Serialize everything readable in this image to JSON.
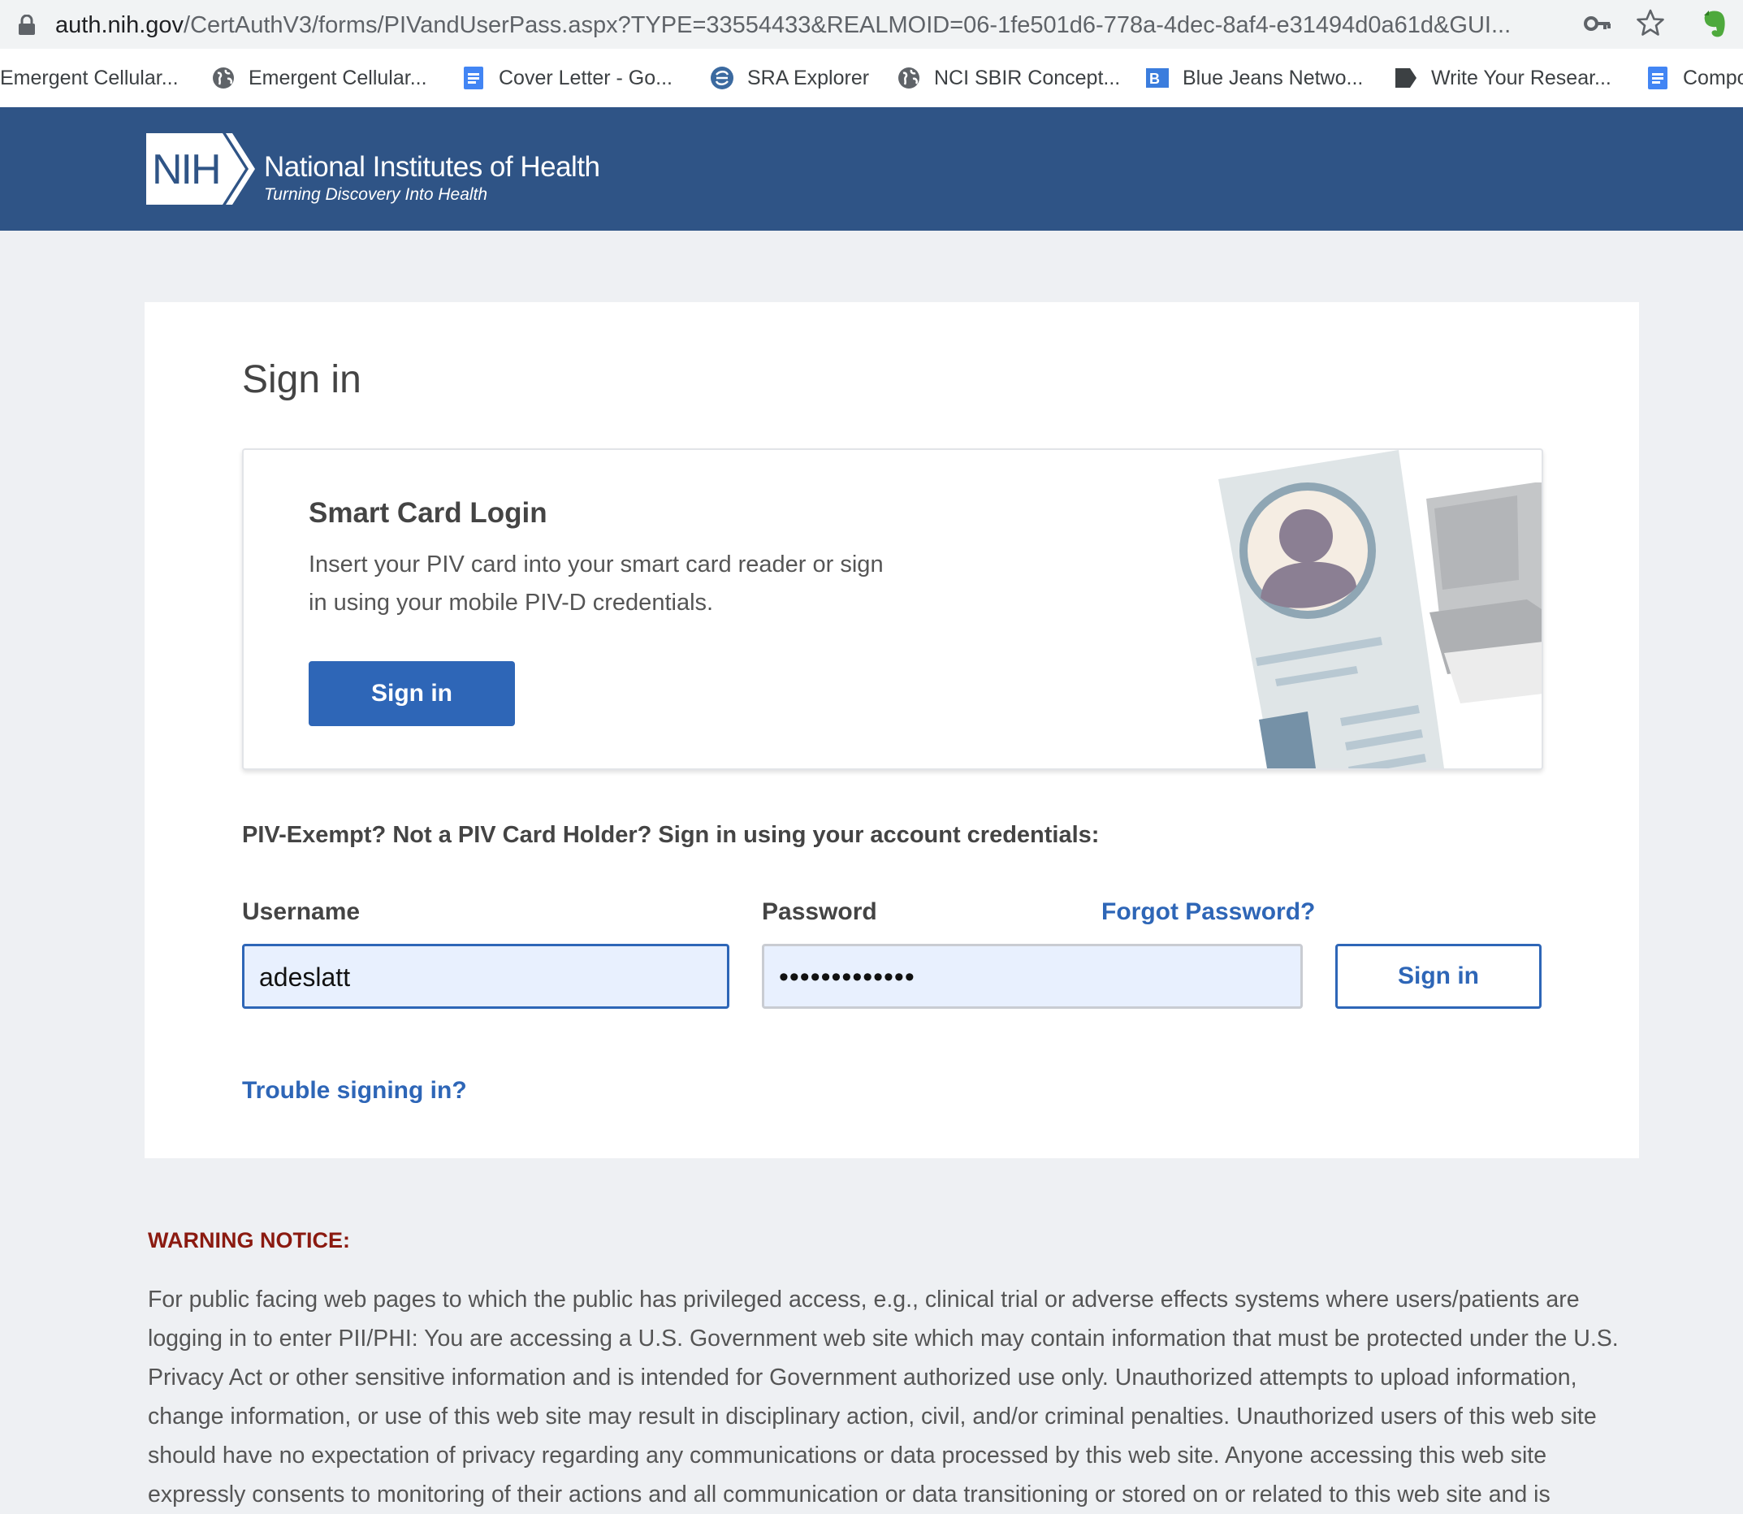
{
  "browser": {
    "url_host": "auth.nih.gov",
    "url_path": "/CertAuthV3/forms/PIVandUserPass.aspx?TYPE=33554433&REALMOID=06-1fe501d6-778a-4dec-8af4-e31494d0a61d&GUI...",
    "icons": [
      "lock-icon",
      "key-icon",
      "star-icon",
      "evernote-icon"
    ]
  },
  "bookmarks": [
    {
      "label": "Emergent Cellular...",
      "icon": "none"
    },
    {
      "label": "Emergent Cellular...",
      "icon": "globe-icon"
    },
    {
      "label": "Cover Letter - Go...",
      "icon": "docs-icon"
    },
    {
      "label": "SRA Explorer",
      "icon": "sra-icon"
    },
    {
      "label": "NCI SBIR Concept...",
      "icon": "globe-icon"
    },
    {
      "label": "Blue Jeans Netwo...",
      "icon": "bluejeans-icon"
    },
    {
      "label": "Write Your Resear...",
      "icon": "flag-icon"
    },
    {
      "label": "Compo",
      "icon": "docs-icon"
    }
  ],
  "header": {
    "logo_text": "NIH",
    "org_name": "National Institutes of Health",
    "tagline": "Turning Discovery Into Health",
    "bg_color": "#2f5486"
  },
  "signin": {
    "title": "Sign in",
    "smart_card": {
      "title": "Smart Card Login",
      "description": "Insert your PIV card into your smart card reader or sign in using your mobile PIV-D credentials.",
      "button_label": "Sign in"
    },
    "alt_heading": "PIV-Exempt? Not a PIV Card Holder? Sign in using your account credentials:",
    "username_label": "Username",
    "username_value": "adeslatt",
    "password_label": "Password",
    "password_value": "•••••••••••••",
    "forgot_password": "Forgot Password?",
    "submit_label": "Sign in",
    "trouble_link": "Trouble signing in?",
    "accent_color": "#2e66b7"
  },
  "warning": {
    "title": "WARNING NOTICE:",
    "text": "For public facing web pages to which the public has privileged access, e.g., clinical trial or adverse effects systems where users/patients are logging in to enter PII/PHI: You are accessing a U.S. Government web site which may contain information that must be protected under the U.S. Privacy Act or other sensitive information and is intended for Government authorized use only. Unauthorized attempts to upload information, change information, or use of this web site may result in disciplinary action, civil, and/or criminal penalties. Unauthorized users of this web site should have no expectation of privacy regarding any communications or data processed by this web site. Anyone accessing this web site expressly consents to monitoring of their actions and all communication or data transitioning or stored on or related to this web site and is",
    "title_color": "#8b1a10"
  }
}
